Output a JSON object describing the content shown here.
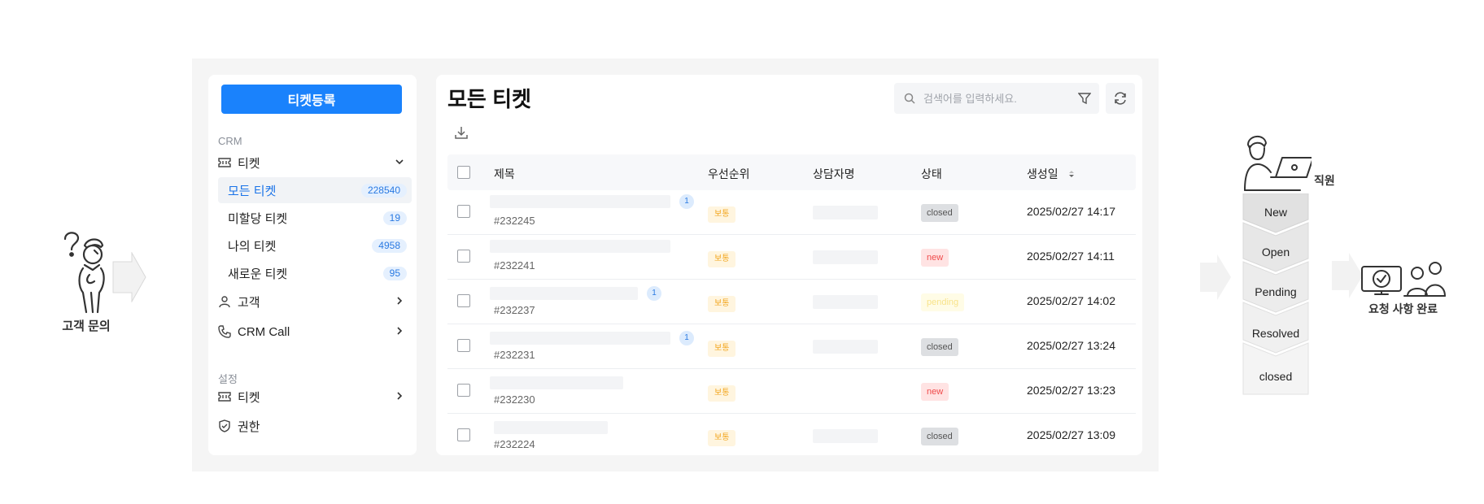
{
  "flow_left": {
    "customer_label": "고객 문의"
  },
  "sidebar": {
    "register_button": "티켓등록",
    "crm_section": "CRM",
    "ticket_menu": "티켓",
    "sub_items": [
      {
        "label": "모든 티켓",
        "count": "228540"
      },
      {
        "label": "미할당 티켓",
        "count": "19"
      },
      {
        "label": "나의 티켓",
        "count": "4958"
      },
      {
        "label": "새로운 티켓",
        "count": "95"
      }
    ],
    "customer_menu": "고객",
    "crm_call_menu": "CRM Call",
    "settings_section": "설정",
    "settings_ticket_menu": "티켓",
    "permission_menu": "권한"
  },
  "main": {
    "title": "모든 티켓",
    "search_placeholder": "검색어를 입력하세요.",
    "columns": {
      "title": "제목",
      "priority": "우선순위",
      "agent": "상담자명",
      "status": "상태",
      "created": "생성일"
    },
    "rows": [
      {
        "id": "#232245",
        "priority": "보통",
        "status": "closed",
        "status_type": "closed",
        "created": "2025/02/27 14:17",
        "replies": "1"
      },
      {
        "id": "#232241",
        "priority": "보통",
        "status": "new",
        "status_type": "new",
        "created": "2025/02/27 14:11",
        "replies": ""
      },
      {
        "id": "#232237",
        "priority": "보통",
        "status": "pending",
        "status_type": "pending",
        "created": "2025/02/27 14:02",
        "replies": "1"
      },
      {
        "id": "#232231",
        "priority": "보통",
        "status": "closed",
        "status_type": "closed",
        "created": "2025/02/27 13:24",
        "replies": "1"
      },
      {
        "id": "#232230",
        "priority": "보통",
        "status": "new",
        "status_type": "new",
        "created": "2025/02/27 13:23",
        "replies": ""
      },
      {
        "id": "#232224",
        "priority": "보통",
        "status": "closed",
        "status_type": "closed",
        "created": "2025/02/27 13:09",
        "replies": ""
      }
    ]
  },
  "flow_right": {
    "staff_label": "직원",
    "steps": [
      "New",
      "Open",
      "Pending",
      "Resolved",
      "closed"
    ],
    "done_label": "요청 사항 완료"
  },
  "colors": {
    "accent": "#1a82fc",
    "priority": "#f2a51d",
    "new": "#f04b4b",
    "closed": "#555555"
  }
}
